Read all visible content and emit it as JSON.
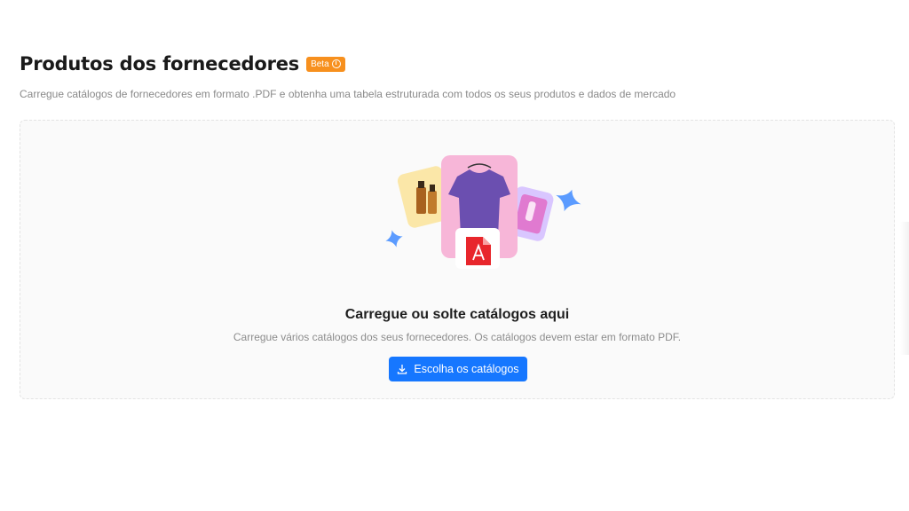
{
  "header": {
    "title": "Produtos dos fornecedores",
    "badge": "Beta",
    "badge_icon": "info-icon",
    "subtitle": "Carregue catálogos de fornecedores em formato .PDF e obtenha uma tabela estruturada com todos os seus produtos e dados de mercado"
  },
  "dropzone": {
    "title": "Carregue ou solte catálogos aqui",
    "description": "Carregue vários catálogos dos seus fornecedores. Os catálogos devem estar em formato PDF.",
    "button_label": "Escolha os catálogos",
    "button_icon": "download-icon",
    "illustration_icons": [
      "perfume-bottle-card",
      "tshirt-card",
      "lipstick-card",
      "pdf-file-icon",
      "sparkle-icon"
    ]
  },
  "colors": {
    "accent": "#1677ff",
    "badge": "#f7901e",
    "pdf": "#e8262c"
  }
}
